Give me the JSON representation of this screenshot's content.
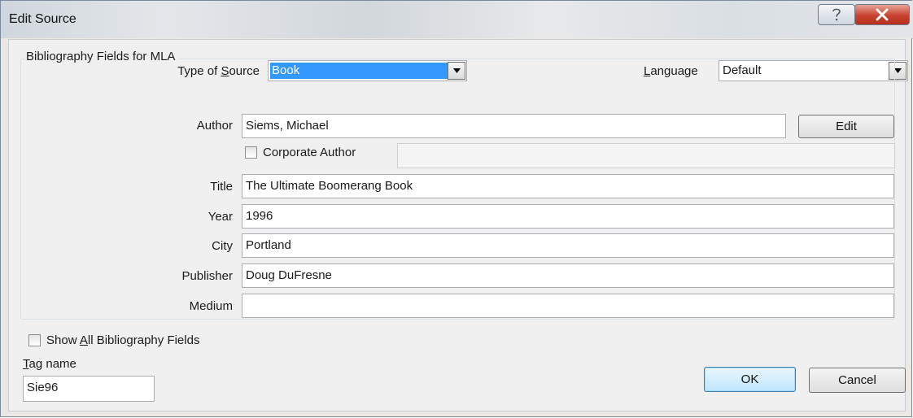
{
  "window": {
    "title": "Edit Source",
    "help_icon": "help-icon",
    "close_icon": "close-icon"
  },
  "type_of_source": {
    "label_prefix": "Type of ",
    "label_key": "S",
    "label_suffix": "ource",
    "value": "Book"
  },
  "language": {
    "label_key": "L",
    "label_suffix": "anguage",
    "value": "Default"
  },
  "group_title": "Bibliography Fields for MLA",
  "fields": {
    "author_label": "Author",
    "author_value": "Siems, Michael",
    "edit_button": "Edit",
    "corporate_author_label": "Corporate Author",
    "corporate_author_checked": false,
    "corporate_author_value": "",
    "title_label": "Title",
    "title_value": "The Ultimate Boomerang Book",
    "year_label": "Year",
    "year_value": "1996",
    "city_label": "City",
    "city_value": "Portland",
    "publisher_label": "Publisher",
    "publisher_value": "Doug DuFresne",
    "medium_label": "Medium",
    "medium_value": ""
  },
  "show_all": {
    "label_prefix": "Show ",
    "label_key": "A",
    "label_suffix": "ll Bibliography Fields",
    "checked": false
  },
  "tag_name": {
    "label_key": "T",
    "label_suffix": "ag name",
    "value": "Sie96"
  },
  "buttons": {
    "ok": "OK",
    "cancel": "Cancel"
  },
  "colors": {
    "selection": "#3399ff",
    "close_button": "#c7422e",
    "default_button": "#bee6fd"
  }
}
